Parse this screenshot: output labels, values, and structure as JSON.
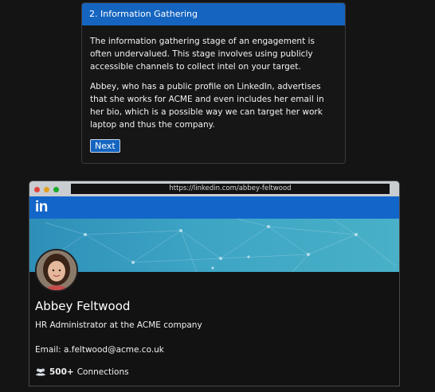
{
  "card": {
    "title": "2. Information Gathering",
    "paragraph1": "The information gathering stage of an engagement is often undervalued. This stage involves using publicly accessible channels to collect intel on your target.",
    "paragraph2": "Abbey, who has a public profile on LinkedIn, advertises that she works for ACME and even includes her email in her bio, which is a possible way we can target her work laptop and thus the company.",
    "next_label": "Next"
  },
  "browser": {
    "url": "https://linkedin.com/abbey-feltwood"
  },
  "linkedin": {
    "logo": "in",
    "name": "Abbey Feltwood",
    "title": "HR Administrator at the ACME company",
    "email": "Email: a.feltwood@acme.co.uk",
    "connections_count": "500+",
    "connections_label": "Connections"
  },
  "colors": {
    "accent": "#1565c0",
    "linkedin_blue": "#1366c9",
    "background": "#141414"
  },
  "icons": {
    "window_controls": [
      "close-dot",
      "minimize-dot",
      "maximize-dot"
    ],
    "connections_icon": "users-icon"
  }
}
